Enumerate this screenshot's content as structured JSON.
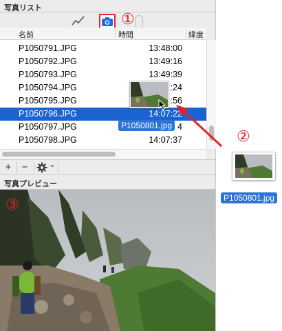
{
  "list_section": {
    "title": "写真リスト",
    "toolbar": {
      "track_icon": "track-line-icon",
      "camera_icon": "camera-icon"
    },
    "columns": [
      "名前",
      "時間",
      "緯度"
    ],
    "rows": [
      {
        "name": "P1050791.JPG",
        "time": "13:48:00"
      },
      {
        "name": "P1050792.JPG",
        "time": "13:49:16"
      },
      {
        "name": "P1050793.JPG",
        "time": "13:49:39"
      },
      {
        "name": "P1050794.JPG",
        "time": ":24"
      },
      {
        "name": "P1050795.JPG",
        "time": ":56"
      },
      {
        "name": "P1050796.JPG",
        "time": "14:07:22"
      },
      {
        "name": "P1050797.JPG",
        "time": "4"
      },
      {
        "name": "P1050798.JPG",
        "time": "14:07:37"
      }
    ],
    "selected_index": 5,
    "bottom_bar": {
      "add": "+",
      "remove": "−",
      "gear_icon": "gear-icon",
      "chevron": "⌄"
    }
  },
  "preview_section": {
    "title": "写真プレビュー"
  },
  "drag": {
    "filename_label": "P1050801.jpg"
  },
  "external": {
    "filename_label": "P1050801.jpg"
  },
  "annotations": {
    "marker1": "①",
    "marker2": "②",
    "marker3": "③"
  },
  "colors": {
    "selection": "#1b63d0",
    "annotation": "#e0242a",
    "label_bg": "#2b73d6"
  }
}
